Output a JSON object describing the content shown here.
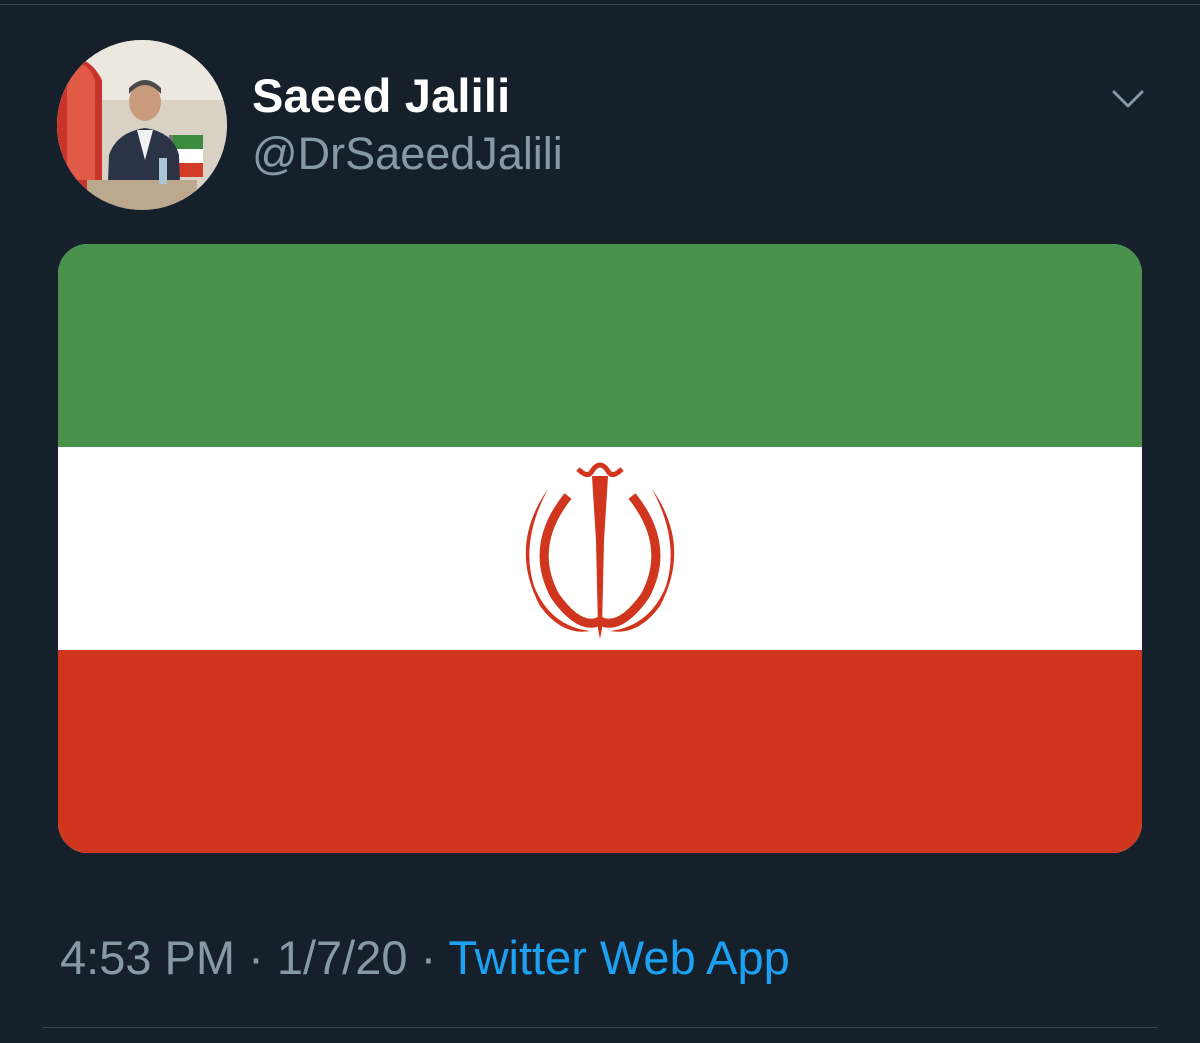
{
  "tweet": {
    "author": {
      "display_name": "Saeed Jalili",
      "handle": "@DrSaeedJalili"
    },
    "menu_icon": "chevron-down-icon",
    "media": {
      "kind": "flag-of-iran",
      "colors": {
        "green": "#49924c",
        "white": "#ffffff",
        "red": "#d0361d"
      }
    },
    "meta": {
      "time": "4:53 PM",
      "separator": "·",
      "date": "1/7/20",
      "source": "Twitter Web App"
    }
  },
  "theme": {
    "background": "#15202b",
    "name_color": "#ffffff",
    "muted_color": "#8899a6",
    "link_color": "#1da1f2"
  }
}
